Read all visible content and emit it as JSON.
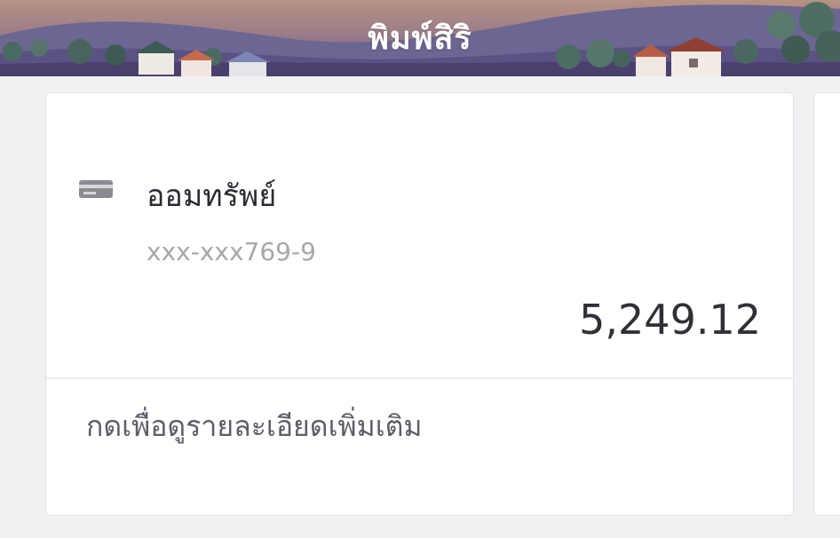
{
  "header": {
    "title": "พิมพ์สิริ"
  },
  "account_card": {
    "icon": "card-icon",
    "name": "ออมทรัพย์",
    "number": "xxx-xxx769-9",
    "balance": "5,249.12",
    "detail_link": "กดเพื่อดูรายละเอียดเพิ่มเติม"
  },
  "colors": {
    "background": "#f1f1f4",
    "card": "#ffffff",
    "header_sky": "#a98790",
    "header_hills": "#5e5a8a"
  }
}
